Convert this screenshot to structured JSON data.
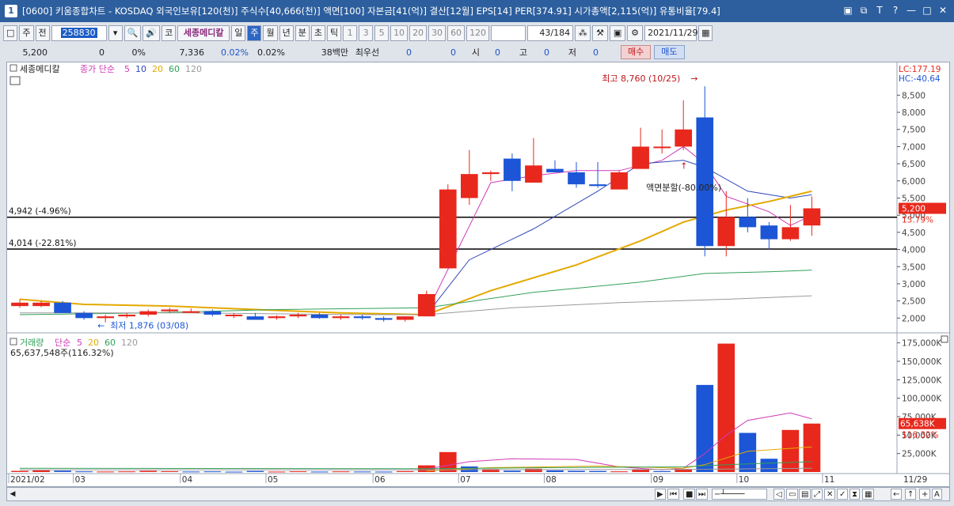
{
  "window": {
    "number": "1",
    "title": "[0600] 키움종합차트 - KOSDAQ 외국인보유[120(천)] 주식수[40,666(천)] 액면[100] 자본금[41(억)] 결산[12월] EPS[14] PER[374.91] 시가총액[2,115(억)] 유통비율[79.4]",
    "buttons": [
      "▣",
      "⧉",
      "T",
      "?",
      "—",
      "□",
      "✕"
    ]
  },
  "toolbar": {
    "frame_btn": "□",
    "main_btn": "주",
    "prev_btn": "전",
    "code": "258830",
    "dropdown": "▾",
    "search_icon": "🔍",
    "sound_icon": "🔊",
    "ko_btn": "코",
    "stock_name": "세종메디칼",
    "periods": [
      "일",
      "주",
      "월",
      "년",
      "분",
      "초",
      "틱"
    ],
    "selected_period": "주",
    "intervals": [
      "1",
      "3",
      "5",
      "10",
      "20",
      "30",
      "60",
      "120"
    ],
    "page": "43",
    "page_total": "/184",
    "date": "2021/11/29"
  },
  "quote": {
    "price": "5,200",
    "change": "0",
    "change_rate": "0%",
    "volume": "7,336",
    "vol_rate1": "0.02%",
    "vol_rate2": "0.02%",
    "trade_value": "38백만",
    "best_label": "최우선",
    "best_ask": "0",
    "best_bid": "0",
    "open_label": "시",
    "open": "0",
    "high_label": "고",
    "high": "0",
    "low_label": "저",
    "low": "0",
    "buy_label": "매수",
    "sell_label": "매도"
  },
  "colors": {
    "up": "#e8281d",
    "down": "#1c56d6",
    "ma5": "#cf3bb7",
    "ma10": "#3047b8",
    "ma20": "#e4a900",
    "ma60": "#32a05a",
    "ma120": "#9a9a9a"
  },
  "chart_data": [
    {
      "type": "candlestick",
      "legend": {
        "name": "세종메디칼",
        "price_label": "종가 단순",
        "periods": [
          "5",
          "10",
          "20",
          "60",
          "120"
        ]
      },
      "lc_label": "LC:177.19",
      "hc_label": "HC:-40.64",
      "y_ticks": [
        "8,500",
        "8,000",
        "7,500",
        "7,000",
        "6,500",
        "6,000",
        "5,500",
        "5,000",
        "4,500",
        "4,000",
        "3,500",
        "3,000",
        "2,500",
        "2,000"
      ],
      "ylim": [
        1800,
        8900
      ],
      "current_price_label": "5,200",
      "current_change_label": "13.79%",
      "current_price": 5200,
      "hlines": [
        {
          "value": 4942,
          "label": "4,942 (-4.96%)"
        },
        {
          "value": 4014,
          "label": "4,014 (-22.81%)"
        }
      ],
      "annotations": {
        "high": "최고 8,760 (10/25)",
        "low": "최저 1,876 (03/08)",
        "split": "액면분할(-80.00%)"
      },
      "candles": [
        {
          "o": 2350,
          "h": 2550,
          "l": 2300,
          "c": 2450
        },
        {
          "o": 2350,
          "h": 2500,
          "l": 2320,
          "c": 2450
        },
        {
          "o": 2450,
          "h": 2500,
          "l": 2150,
          "c": 2150
        },
        {
          "o": 2150,
          "h": 2200,
          "l": 1950,
          "c": 2000
        },
        {
          "o": 2000,
          "h": 2100,
          "l": 1876,
          "c": 2050
        },
        {
          "o": 2050,
          "h": 2150,
          "l": 2000,
          "c": 2100
        },
        {
          "o": 2100,
          "h": 2250,
          "l": 2050,
          "c": 2200
        },
        {
          "o": 2200,
          "h": 2300,
          "l": 2150,
          "c": 2250
        },
        {
          "o": 2200,
          "h": 2280,
          "l": 2150,
          "c": 2200
        },
        {
          "o": 2200,
          "h": 2250,
          "l": 2050,
          "c": 2100
        },
        {
          "o": 2100,
          "h": 2150,
          "l": 2000,
          "c": 2100
        },
        {
          "o": 2050,
          "h": 2150,
          "l": 2000,
          "c": 1950
        },
        {
          "o": 2000,
          "h": 2080,
          "l": 1950,
          "c": 2050
        },
        {
          "o": 2050,
          "h": 2150,
          "l": 2000,
          "c": 2100
        },
        {
          "o": 2100,
          "h": 2150,
          "l": 1980,
          "c": 2000
        },
        {
          "o": 2000,
          "h": 2100,
          "l": 1950,
          "c": 2050
        },
        {
          "o": 2050,
          "h": 2100,
          "l": 1950,
          "c": 2000
        },
        {
          "o": 2000,
          "h": 2050,
          "l": 1900,
          "c": 1950
        },
        {
          "o": 1950,
          "h": 2050,
          "l": 1900,
          "c": 2050
        },
        {
          "o": 2050,
          "h": 2800,
          "l": 2050,
          "c": 2700
        },
        {
          "o": 3450,
          "h": 5900,
          "l": 3450,
          "c": 5750
        },
        {
          "o": 5500,
          "h": 6900,
          "l": 5300,
          "c": 6200
        },
        {
          "o": 6200,
          "h": 6300,
          "l": 6000,
          "c": 6250
        },
        {
          "o": 6650,
          "h": 6800,
          "l": 5700,
          "c": 6000
        },
        {
          "o": 5950,
          "h": 7250,
          "l": 5950,
          "c": 6450
        },
        {
          "o": 6350,
          "h": 6600,
          "l": 6250,
          "c": 6250
        },
        {
          "o": 6250,
          "h": 6550,
          "l": 5800,
          "c": 5900
        },
        {
          "o": 5900,
          "h": 6550,
          "l": 5800,
          "c": 5850
        },
        {
          "o": 5750,
          "h": 6300,
          "l": 5750,
          "c": 6250
        },
        {
          "o": 6350,
          "h": 7550,
          "l": 6350,
          "c": 7000
        },
        {
          "o": 7000,
          "h": 7500,
          "l": 6800,
          "c": 7000
        },
        {
          "o": 7000,
          "h": 8350,
          "l": 6900,
          "c": 7500
        },
        {
          "o": 7850,
          "h": 8760,
          "l": 3800,
          "c": 4100
        },
        {
          "o": 4100,
          "h": 5700,
          "l": 3800,
          "c": 4950
        },
        {
          "o": 4950,
          "h": 5500,
          "l": 4500,
          "c": 4650
        },
        {
          "o": 4700,
          "h": 4800,
          "l": 4000,
          "c": 4300
        },
        {
          "o": 4300,
          "h": 5300,
          "l": 4250,
          "c": 4650
        },
        {
          "o": 4700,
          "h": 5550,
          "l": 4400,
          "c": 5200
        }
      ],
      "moving_averages": {
        "ma5": [
          [
            19,
            2150
          ],
          [
            22,
            5950
          ],
          [
            24,
            6150
          ],
          [
            26,
            6300
          ],
          [
            28,
            6300
          ],
          [
            30,
            6600
          ],
          [
            31,
            7000
          ],
          [
            32,
            6500
          ],
          [
            33,
            5550
          ],
          [
            35,
            5100
          ],
          [
            36,
            4700
          ],
          [
            37,
            5000
          ]
        ],
        "ma10": [
          [
            19,
            2100
          ],
          [
            21,
            3700
          ],
          [
            24,
            4600
          ],
          [
            27,
            5700
          ],
          [
            29,
            6500
          ],
          [
            31,
            6600
          ],
          [
            32,
            6400
          ],
          [
            34,
            5700
          ],
          [
            36,
            5500
          ],
          [
            37,
            5600
          ]
        ],
        "ma20": [
          [
            0,
            2550
          ],
          [
            3,
            2400
          ],
          [
            7,
            2350
          ],
          [
            11,
            2250
          ],
          [
            15,
            2150
          ],
          [
            19,
            2100
          ],
          [
            22,
            2800
          ],
          [
            26,
            3550
          ],
          [
            29,
            4250
          ],
          [
            31,
            4800
          ],
          [
            33,
            5150
          ],
          [
            35,
            5400
          ],
          [
            37,
            5700
          ]
        ],
        "ma60": [
          [
            0,
            2100
          ],
          [
            6,
            2150
          ],
          [
            12,
            2250
          ],
          [
            19,
            2300
          ],
          [
            24,
            2750
          ],
          [
            29,
            3050
          ],
          [
            32,
            3300
          ],
          [
            35,
            3350
          ],
          [
            37,
            3400
          ]
        ],
        "ma120": [
          [
            0,
            2150
          ],
          [
            8,
            2150
          ],
          [
            16,
            2100
          ],
          [
            19,
            2100
          ],
          [
            23,
            2300
          ],
          [
            28,
            2450
          ],
          [
            33,
            2550
          ],
          [
            37,
            2650
          ]
        ]
      }
    },
    {
      "type": "bar",
      "legend": {
        "name": "거래량",
        "label": "단순",
        "periods": [
          "5",
          "20",
          "60",
          "120"
        ]
      },
      "volume_label": "65,637,548주(116.32%)",
      "current_volume_label": "65,638K",
      "current_ratio_label": "116.32%",
      "current_volume": 65638,
      "y_ticks": [
        "175,000K",
        "150,000K",
        "125,000K",
        "100,000K",
        "75,000K",
        "50,000K",
        "25,000K"
      ],
      "ylim": [
        0,
        180000
      ],
      "values": [
        1500,
        2200,
        1800,
        900,
        700,
        900,
        1600,
        1100,
        700,
        900,
        500,
        1400,
        600,
        1000,
        600,
        900,
        700,
        600,
        1200,
        9000,
        27000,
        7500,
        4000,
        1800,
        4500,
        2200,
        1600,
        1400,
        900,
        3500,
        1200,
        4000,
        118000,
        174000,
        53000,
        18000,
        57000,
        65638
      ],
      "up": [
        true,
        true,
        false,
        false,
        true,
        true,
        true,
        true,
        false,
        false,
        false,
        false,
        true,
        true,
        false,
        true,
        false,
        false,
        true,
        true,
        true,
        false,
        true,
        false,
        true,
        false,
        false,
        false,
        true,
        true,
        false,
        true,
        false,
        true,
        false,
        false,
        true,
        true
      ],
      "moving_averages": {
        "ma5": [
          [
            19,
            4000
          ],
          [
            21,
            14000
          ],
          [
            23,
            18000
          ],
          [
            26,
            17000
          ],
          [
            28,
            7000
          ],
          [
            30,
            3000
          ],
          [
            31,
            5000
          ],
          [
            32,
            25000
          ],
          [
            33,
            50000
          ],
          [
            34,
            70000
          ],
          [
            35,
            75000
          ],
          [
            36,
            80000
          ],
          [
            37,
            72000
          ]
        ],
        "ma20": [
          [
            19,
            1500
          ],
          [
            22,
            6000
          ],
          [
            27,
            8000
          ],
          [
            31,
            5000
          ],
          [
            32,
            10000
          ],
          [
            34,
            28000
          ],
          [
            36,
            32000
          ],
          [
            37,
            34000
          ]
        ],
        "ma60": [
          [
            0,
            5000
          ],
          [
            19,
            4500
          ],
          [
            25,
            6000
          ],
          [
            31,
            7000
          ],
          [
            33,
            10000
          ],
          [
            37,
            14000
          ]
        ],
        "ma120": [
          [
            0,
            3000
          ],
          [
            19,
            3000
          ],
          [
            31,
            3500
          ],
          [
            37,
            5000
          ]
        ]
      }
    }
  ],
  "x_axis": {
    "labels": [
      "2021/02",
      "03",
      "04",
      "05",
      "06",
      "07",
      "08",
      "09",
      "10",
      "11"
    ],
    "label_index": [
      0,
      3,
      8,
      12,
      17,
      21,
      25,
      30,
      34,
      38
    ],
    "last_date": "11/29"
  },
  "scroll": {
    "play": "▶",
    "first": "⏮",
    "stop": "■",
    "last": "⏭",
    "tools": [
      "◁",
      "▭",
      "▤",
      "⤢",
      "✕",
      "✓",
      "⧗",
      "▦",
      "←",
      "↑",
      "+",
      "A"
    ]
  }
}
